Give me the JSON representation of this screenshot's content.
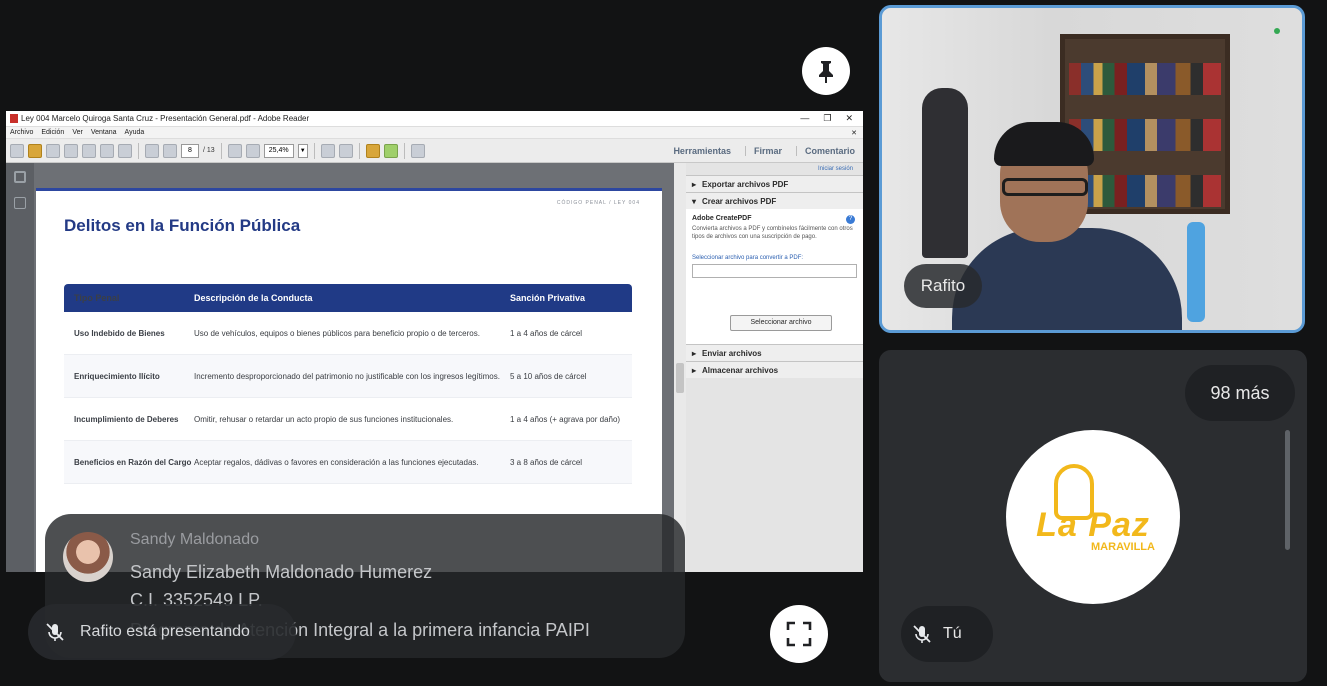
{
  "reader": {
    "window_title": "Ley 004 Marcelo Quiroga Santa Cruz - Presentación General.pdf - Adobe Reader",
    "menu": [
      "Archivo",
      "Edición",
      "Ver",
      "Ventana",
      "Ayuda"
    ],
    "page_current": "8",
    "page_total": "/ 13",
    "zoom": "25,4%",
    "right_tabs": [
      "Herramientas",
      "Firmar",
      "Comentario"
    ],
    "sign_in": "Iniciar sesión",
    "panel": {
      "export": "Exportar archivos PDF",
      "create": "Crear archivos PDF",
      "create_title": "Adobe CreatePDF",
      "create_desc": "Convierta archivos a PDF y combínelos fácilmente con otros tipos de archivos con una suscripción de pago.",
      "select_label": "Seleccionar archivo para convertir a PDF:",
      "select_button": "Seleccionar archivo",
      "send": "Enviar archivos",
      "store": "Almacenar archivos"
    }
  },
  "slide": {
    "code_tag": "CÓDIGO PENAL / LEY 004",
    "title": "Delitos en la Función Pública",
    "headers": [
      "Tipo Penal",
      "Descripción de la Conducta",
      "Sanción Privativa"
    ],
    "rows": [
      [
        "Uso Indebido de Bienes",
        "Uso de vehículos, equipos o bienes públicos para beneficio propio o de terceros.",
        "1 a 4 años de cárcel"
      ],
      [
        "Enriquecimiento Ilícito",
        "Incremento desproporcionado del patrimonio no justificable con los ingresos legítimos.",
        "5 a 10 años de cárcel"
      ],
      [
        "Incumplimiento de Deberes",
        "Omitir, rehusar o retardar un acto propio de sus funciones institucionales.",
        "1 a 4 años (+ agrava por daño)"
      ],
      [
        "Beneficios en Razón del Cargo",
        "Aceptar regalos, dádivas o favores en consideración a las funciones ejecutadas.",
        "3 a 8 años de cárcel"
      ]
    ]
  },
  "caption": {
    "name": "Sandy Maldonado",
    "lines": [
      "Sandy Elizabeth Maldonado Humerez",
      "C.I. 3352549 LP.",
      "Programa de Atención Integral a la primera infancia  PAIPI"
    ]
  },
  "presenting": "Rafito está presentando",
  "participants": {
    "rafito_name": "Rafito",
    "more": "98 más",
    "you": "Tú",
    "logo_main": "La Paz",
    "logo_sub": "MARAVILLA"
  }
}
